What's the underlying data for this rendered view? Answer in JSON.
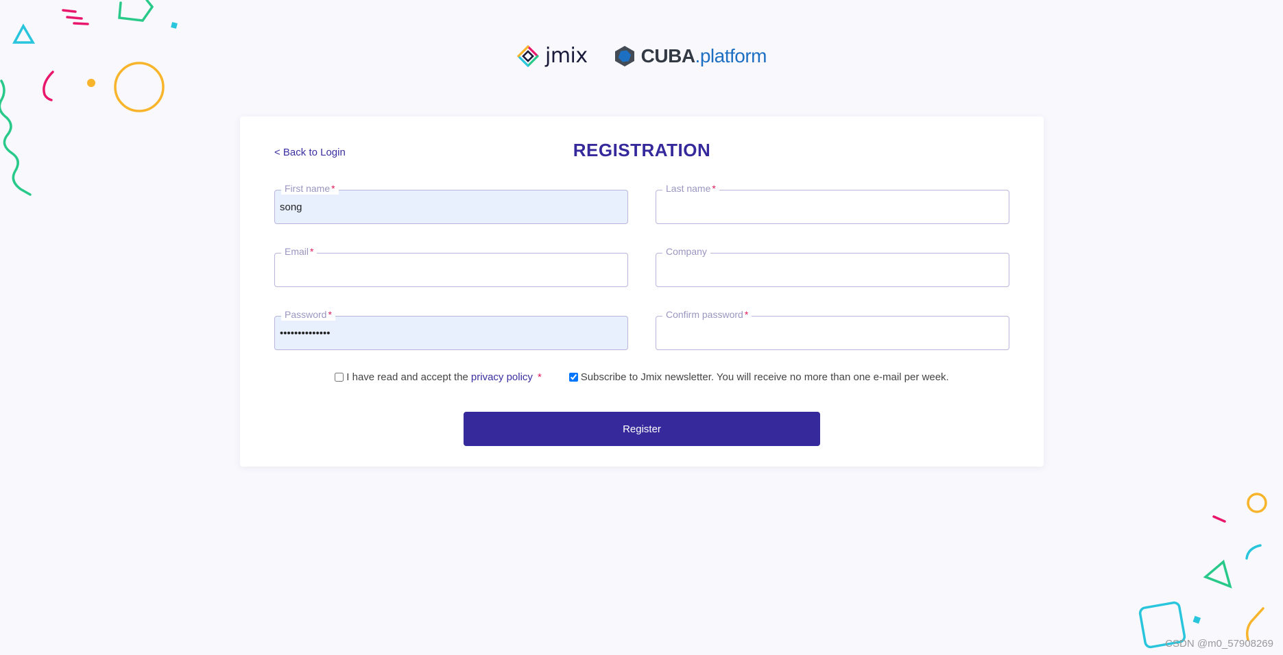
{
  "logos": {
    "jmix": "jmix",
    "cuba_main": "CUBA",
    "cuba_suffix": ".platform"
  },
  "form": {
    "back_link": "< Back to Login",
    "title": "REGISTRATION",
    "required_mark": "*",
    "fields": {
      "first_name": {
        "label": "First name",
        "value": "song"
      },
      "last_name": {
        "label": "Last name",
        "value": ""
      },
      "email": {
        "label": "Email",
        "value": ""
      },
      "company": {
        "label": "Company",
        "value": ""
      },
      "password": {
        "label": "Password",
        "value": "abcdefghijklmn"
      },
      "confirm_password": {
        "label": "Confirm password",
        "value": ""
      }
    },
    "privacy": {
      "prefix": "I have read and accept the",
      "link": "privacy policy",
      "checked": false
    },
    "newsletter": {
      "label": "Subscribe to Jmix newsletter. You will receive no more than one e-mail per week.",
      "checked": true
    },
    "register_button": "Register"
  },
  "watermark": "CSDN @m0_57908269",
  "colors": {
    "accent": "#35299b",
    "required": "#e0195d",
    "autofill": "#e8f0fe",
    "background": "#f8f8fd"
  }
}
